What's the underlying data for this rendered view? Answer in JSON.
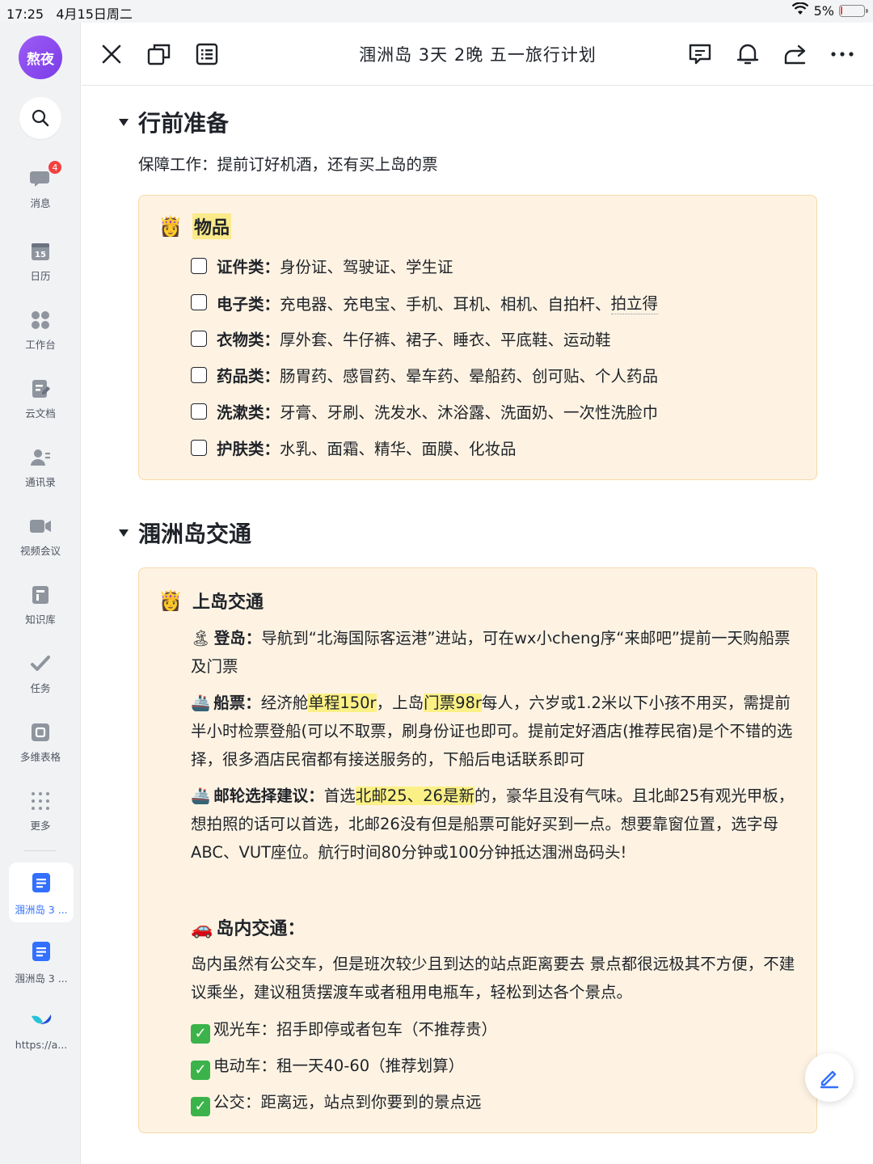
{
  "status_bar": {
    "time": "17:25",
    "date": "4月15日周二",
    "battery": "5%"
  },
  "sidebar": {
    "avatar_text": "熬夜",
    "nav": [
      {
        "label": "消息",
        "badge": "4"
      },
      {
        "label": "日历",
        "icon_text": "15"
      },
      {
        "label": "工作台"
      },
      {
        "label": "云文档"
      },
      {
        "label": "通讯录"
      },
      {
        "label": "视频会议"
      },
      {
        "label": "知识库"
      },
      {
        "label": "任务"
      },
      {
        "label": "多维表格"
      },
      {
        "label": "更多"
      }
    ],
    "recent": [
      {
        "label": "涠洲岛 3 ..."
      },
      {
        "label": "涠洲岛 3 ..."
      },
      {
        "label": "https://a..."
      }
    ]
  },
  "toolbar": {
    "title": "涠洲岛 3天 2晚 五一旅行计划"
  },
  "section1": {
    "heading": "行前准备",
    "intro": "保障工作：提前订好机酒，还有买上岛的票",
    "callout": {
      "emoji": "👸",
      "title": "物品",
      "items": [
        {
          "label": "证件类：",
          "text": "身份证、驾驶证、学生证"
        },
        {
          "label": "电子类：",
          "text": "充电器、充电宝、手机、耳机、相机、自拍杆、",
          "underlined": "拍立得"
        },
        {
          "label": "衣物类：",
          "text": "厚外套、牛仔裤、裙子、睡衣、平底鞋、运动鞋"
        },
        {
          "label": "药品类：",
          "text": "肠胃药、感冒药、晕车药、晕船药、创可贴、个人药品"
        },
        {
          "label": "洗漱类：",
          "text": "牙膏、牙刷、洗发水、沐浴露、洗面奶、一次性洗脸巾"
        },
        {
          "label": "护肤类：",
          "text": "水乳、面霜、精华、面膜、化妆品"
        }
      ]
    }
  },
  "section2": {
    "heading": "涠洲岛交通",
    "callout": {
      "emoji": "👸",
      "title": "上岛交通",
      "boarding": {
        "emoji": "🏝",
        "label": "登岛：",
        "text": "导航到“北海国际客运港”进站，可在wx小cheng序“来邮吧”提前一天购船票及门票"
      },
      "ticket": {
        "emoji": "🚢",
        "label": "船票：",
        "t1": "经济舱",
        "hl1": "单程150r",
        "t2": "，上岛",
        "hl2": "门票98r",
        "t3": "每人，六岁或1.2米以下小孩不用买，需提前半小时检票登船(可以不取票，刷身份证也即可。提前定好酒店(推荐民宿)是个不错的选择，很多酒店民宿都有接送服务的，下船后电话联系即可"
      },
      "cruise": {
        "emoji": "🚢",
        "label": "邮轮选择建议：",
        "t1": "首选",
        "hl1": "北邮25、26是新",
        "t2": "的，豪华且没有气味。且北邮25有观光甲板，想拍照的话可以首选，北邮26没有但是船票可能好买到一点。想要靠窗位置，选字母ABC、VUT座位。航行时间80分钟或100分钟抵达涠洲岛码头!"
      },
      "island": {
        "emoji": "🚗",
        "heading": "岛内交通：",
        "text": "岛内虽然有公交车，但是班次较少且到达的站点距离要去 景点都很远极其不方便，不建议乘坐，建议租赁摆渡车或者租用电瓶车，轻松到达各个景点。",
        "options": [
          "观光车：招手即停或者包车（不推荐贵）",
          "电动车：租一天40-60（推荐划算）",
          "公交：距离远，站点到你要到的景点远"
        ]
      }
    }
  }
}
